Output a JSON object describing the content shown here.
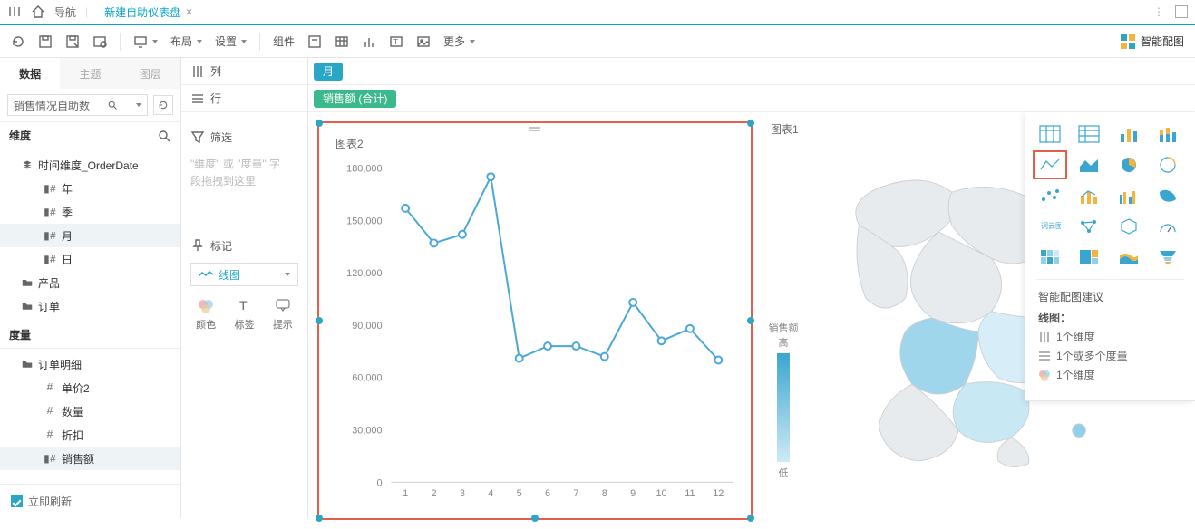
{
  "titlebar": {
    "nav_label": "导航",
    "tab_label": "新建自助仪表盘",
    "close": "×"
  },
  "toolbar": {
    "layout": "布局",
    "settings": "设置",
    "component": "组件",
    "more": "更多",
    "smart_chart": "智能配图"
  },
  "left_tabs": {
    "data": "数据",
    "theme": "主题",
    "layer": "图层"
  },
  "data_source": {
    "name": "销售情况自助数"
  },
  "dims": {
    "header": "维度",
    "time_group": "时间维度_OrderDate",
    "year": "年",
    "quarter": "季",
    "month": "月",
    "day": "日",
    "product": "产品",
    "order": "订单"
  },
  "measures": {
    "header": "度量",
    "detail_group": "订单明细",
    "price2": "单价2",
    "qty": "数量",
    "discount": "折扣",
    "sales": "销售额"
  },
  "footer": {
    "refresh_now": "立即刷新"
  },
  "config": {
    "cols": "列",
    "rows": "行",
    "filter": "筛选",
    "filter_hint1": "\"维度\" 或 \"度量\" 字",
    "filter_hint2": "段拖拽到这里",
    "mark": "标记",
    "chart_type": "线图",
    "color": "颜色",
    "label": "标签",
    "tooltip": "提示"
  },
  "shelf": {
    "col_pill": "月",
    "row_pill": "销售额 (合计)"
  },
  "chart2": {
    "title": "图表2"
  },
  "chart1": {
    "title": "图表1",
    "legend_title": "销售额",
    "high": "高",
    "low": "低"
  },
  "smart": {
    "advice_hd": "智能配图建议",
    "chart_kind": "线图：",
    "r1": "1个维度",
    "r2": "1个或多个度量",
    "r3": "1个维度"
  },
  "chart_data": {
    "type": "line",
    "title": "图表2",
    "xlabel": "",
    "ylabel": "",
    "ylim": [
      0,
      180000
    ],
    "yticks": [
      0,
      30000,
      60000,
      90000,
      120000,
      150000,
      180000
    ],
    "ytick_labels": [
      "0",
      "30,000",
      "60,000",
      "90,000",
      "120,000",
      "150,000",
      "180,000"
    ],
    "categories": [
      "1",
      "2",
      "3",
      "4",
      "5",
      "6",
      "7",
      "8",
      "9",
      "10",
      "11",
      "12"
    ],
    "values": [
      157000,
      137000,
      142000,
      175000,
      71000,
      78000,
      78000,
      72000,
      103000,
      81000,
      88000,
      70000
    ]
  }
}
